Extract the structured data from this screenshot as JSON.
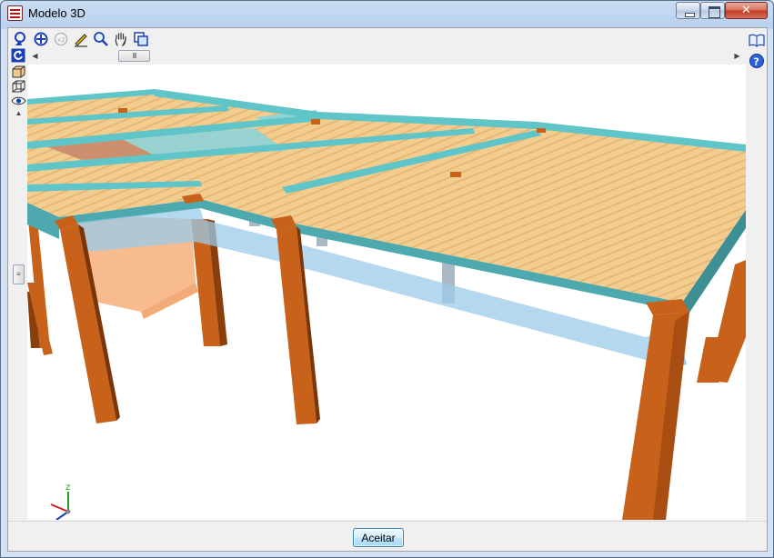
{
  "window": {
    "title": "Modelo 3D",
    "close_glyph": "✕"
  },
  "toolbar": {
    "tools": [
      {
        "name": "rotate-view-icon"
      },
      {
        "name": "zoom-window-icon"
      },
      {
        "name": "zoom-previous-icon"
      },
      {
        "name": "edit-pencil-icon"
      },
      {
        "name": "zoom-magnifier-icon"
      },
      {
        "name": "pan-hand-icon"
      },
      {
        "name": "copy-view-icon"
      }
    ]
  },
  "left_tools": [
    {
      "name": "undo-rotate-icon"
    },
    {
      "name": "solid-view-icon"
    },
    {
      "name": "wireframe-view-icon"
    },
    {
      "name": "visibility-eye-icon"
    }
  ],
  "right_tools": [
    {
      "name": "help-book-icon"
    },
    {
      "name": "help-question-icon"
    }
  ],
  "scrollbars": {
    "h_left_arrow": "◀",
    "h_right_arrow": "▶",
    "h_thumb_grip": "III",
    "v_up_arrow": "▲",
    "v_thumb_grip": "≡"
  },
  "viewport": {
    "axis_label": "z",
    "colors": {
      "slab": "#f2c98a",
      "beam": "#5fc5c8",
      "column": "#c8621a",
      "glass_beam": "#9ccbe9"
    }
  },
  "footer": {
    "accept_label": "Aceitar"
  }
}
